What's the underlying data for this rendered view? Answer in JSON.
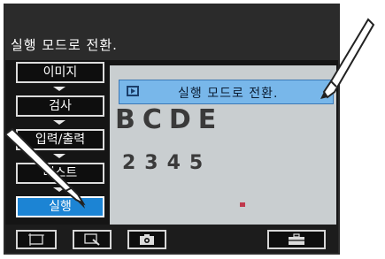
{
  "header": {
    "message": "실행 모드로 전환."
  },
  "tooltip": {
    "icon": "play-box-icon",
    "text": "실행 모드로 전환."
  },
  "viewport": {
    "line1": "BCDE",
    "line2": "2345"
  },
  "menu": {
    "items": [
      {
        "label": "이미지",
        "active": false
      },
      {
        "label": "검사",
        "active": false
      },
      {
        "label": "입력/출력",
        "active": false
      },
      {
        "label": "테스트",
        "active": false
      },
      {
        "label": "실행",
        "active": true
      }
    ]
  },
  "toolbar": {
    "buttons": [
      {
        "icon": "frame-icon"
      },
      {
        "icon": "zoom-region-icon"
      },
      {
        "icon": "camera-icon"
      },
      {
        "icon": "toolbox-icon"
      }
    ]
  },
  "colors": {
    "accent": "#1c84d4",
    "tooltip": "#78b7ea",
    "marker": "#c0394d"
  }
}
